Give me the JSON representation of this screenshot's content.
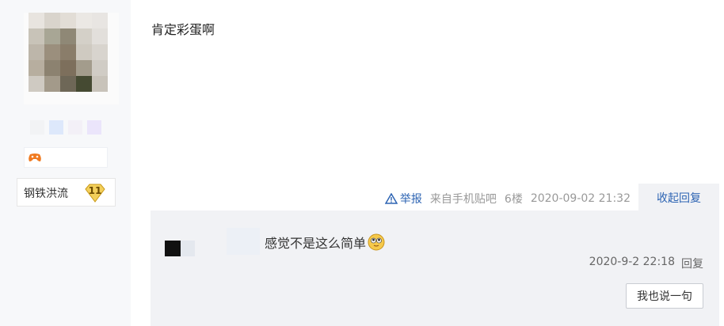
{
  "post": {
    "content": "肯定彩蛋啊",
    "report_label": "举报",
    "source": "来自手机贴吧",
    "floor": "6楼",
    "time": "2020-09-02 21:32",
    "collapse_label": "收起回复"
  },
  "author": {
    "avatar_icon": "pixelated-avatar-icon",
    "game_icon": "game-controller-icon",
    "level_name": "钢铁洪流",
    "level": "11"
  },
  "reply": {
    "text": "感觉不是这么简单",
    "emoji": "shy-face-emoji-icon",
    "time": "2020-9-2 22:18",
    "reply_label": "回复",
    "say_button": "我也说一句"
  },
  "colors": {
    "link": "#2d64b3",
    "panel": "#f1f2f5",
    "left_col": "#f7f8fa"
  }
}
